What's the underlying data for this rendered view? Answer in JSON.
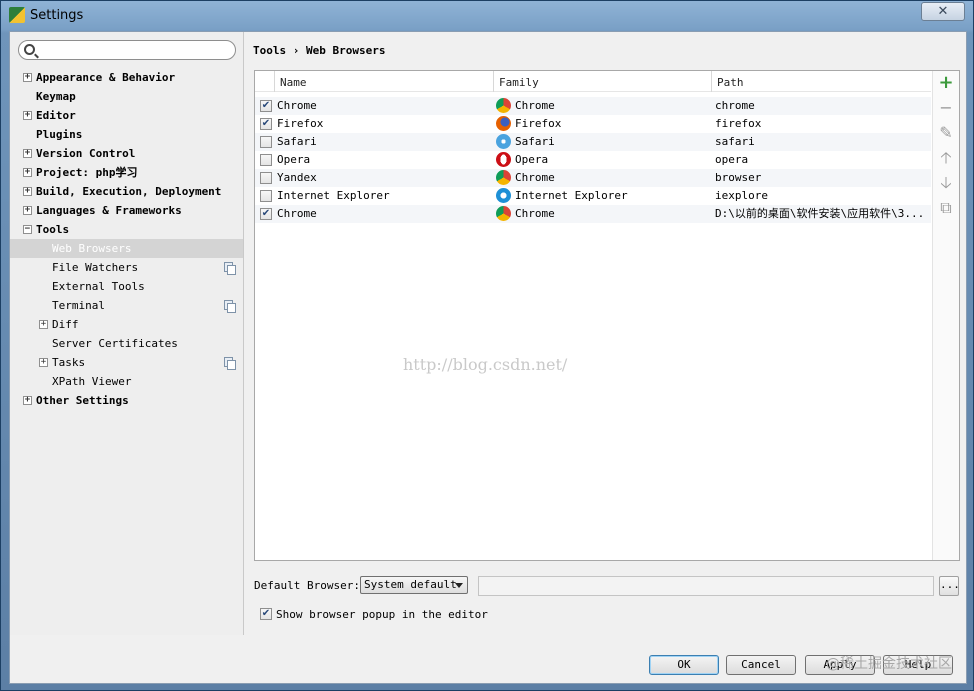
{
  "window": {
    "title": "Settings",
    "close_glyph": "✕"
  },
  "search": {
    "value": "",
    "placeholder": ""
  },
  "tree": [
    {
      "label": "Appearance & Behavior",
      "level": 0,
      "bold": true,
      "expander": "+",
      "copy": false,
      "selected": false
    },
    {
      "label": "Keymap",
      "level": 0,
      "bold": true,
      "expander": "",
      "copy": false,
      "selected": false
    },
    {
      "label": "Editor",
      "level": 0,
      "bold": true,
      "expander": "+",
      "copy": false,
      "selected": false
    },
    {
      "label": "Plugins",
      "level": 0,
      "bold": true,
      "expander": "",
      "copy": false,
      "selected": false
    },
    {
      "label": "Version Control",
      "level": 0,
      "bold": true,
      "expander": "+",
      "copy": false,
      "selected": false
    },
    {
      "label": "Project: php学习",
      "level": 0,
      "bold": true,
      "expander": "+",
      "copy": false,
      "selected": false
    },
    {
      "label": "Build, Execution, Deployment",
      "level": 0,
      "bold": true,
      "expander": "+",
      "copy": false,
      "selected": false
    },
    {
      "label": "Languages & Frameworks",
      "level": 0,
      "bold": true,
      "expander": "+",
      "copy": false,
      "selected": false
    },
    {
      "label": "Tools",
      "level": 0,
      "bold": true,
      "expander": "−",
      "copy": false,
      "selected": false
    },
    {
      "label": "Web Browsers",
      "level": 1,
      "bold": false,
      "expander": "",
      "copy": false,
      "selected": true
    },
    {
      "label": "File Watchers",
      "level": 1,
      "bold": false,
      "expander": "",
      "copy": true,
      "selected": false
    },
    {
      "label": "External Tools",
      "level": 1,
      "bold": false,
      "expander": "",
      "copy": false,
      "selected": false
    },
    {
      "label": "Terminal",
      "level": 1,
      "bold": false,
      "expander": "",
      "copy": true,
      "selected": false
    },
    {
      "label": "Diff",
      "level": 1,
      "bold": false,
      "expander": "+",
      "copy": false,
      "selected": false
    },
    {
      "label": "Server Certificates",
      "level": 1,
      "bold": false,
      "expander": "",
      "copy": false,
      "selected": false
    },
    {
      "label": "Tasks",
      "level": 1,
      "bold": false,
      "expander": "+",
      "copy": true,
      "selected": false
    },
    {
      "label": "XPath Viewer",
      "level": 1,
      "bold": false,
      "expander": "",
      "copy": false,
      "selected": false
    },
    {
      "label": "Other Settings",
      "level": 0,
      "bold": true,
      "expander": "+",
      "copy": false,
      "selected": false
    }
  ],
  "breadcrumb": {
    "parent": "Tools",
    "separator": "›",
    "current": "Web Browsers"
  },
  "table": {
    "columns": [
      "Name",
      "Family",
      "Path"
    ],
    "rows": [
      {
        "checked": true,
        "name": "Chrome",
        "family": "Chrome",
        "family_icon": "chrome-icon",
        "path": "chrome"
      },
      {
        "checked": true,
        "name": "Firefox",
        "family": "Firefox",
        "family_icon": "firefox-icon",
        "path": "firefox"
      },
      {
        "checked": false,
        "name": "Safari",
        "family": "Safari",
        "family_icon": "safari-icon",
        "path": "safari"
      },
      {
        "checked": false,
        "name": "Opera",
        "family": "Opera",
        "family_icon": "opera-icon",
        "path": "opera"
      },
      {
        "checked": false,
        "name": "Yandex",
        "family": "Chrome",
        "family_icon": "chrome-icon",
        "path": "browser"
      },
      {
        "checked": false,
        "name": "Internet Explorer",
        "family": "Internet Explorer",
        "family_icon": "ie-icon",
        "path": "iexplore"
      },
      {
        "checked": true,
        "name": "Chrome",
        "family": "Chrome",
        "family_icon": "chrome-icon",
        "path": "D:\\以前的桌面\\软件安装\\应用软件\\3..."
      }
    ]
  },
  "side_tools": [
    {
      "name": "add-icon",
      "glyph": "+"
    },
    {
      "name": "remove-icon",
      "glyph": "−"
    },
    {
      "name": "edit-icon",
      "glyph": "✎"
    },
    {
      "name": "move-up-icon",
      "glyph": "🡡"
    },
    {
      "name": "move-down-icon",
      "glyph": "🡣"
    },
    {
      "name": "copy-icon",
      "glyph": "⧉"
    }
  ],
  "watermark": "http://blog.csdn.net/",
  "default_browser": {
    "label": "Default Browser:",
    "value": "System default",
    "path_value": "",
    "browse_label": "..."
  },
  "popup_option": {
    "checked": true,
    "label": "Show browser popup in the editor"
  },
  "buttons": {
    "ok": "OK",
    "cancel": "Cancel",
    "apply": "Apply",
    "help": "Help"
  },
  "corner_watermark": "@稀土掘金技术社区",
  "colors": {
    "accent": "#3c7fb1",
    "selection": "#d4d4d4",
    "add_green": "#3c9a3c"
  }
}
